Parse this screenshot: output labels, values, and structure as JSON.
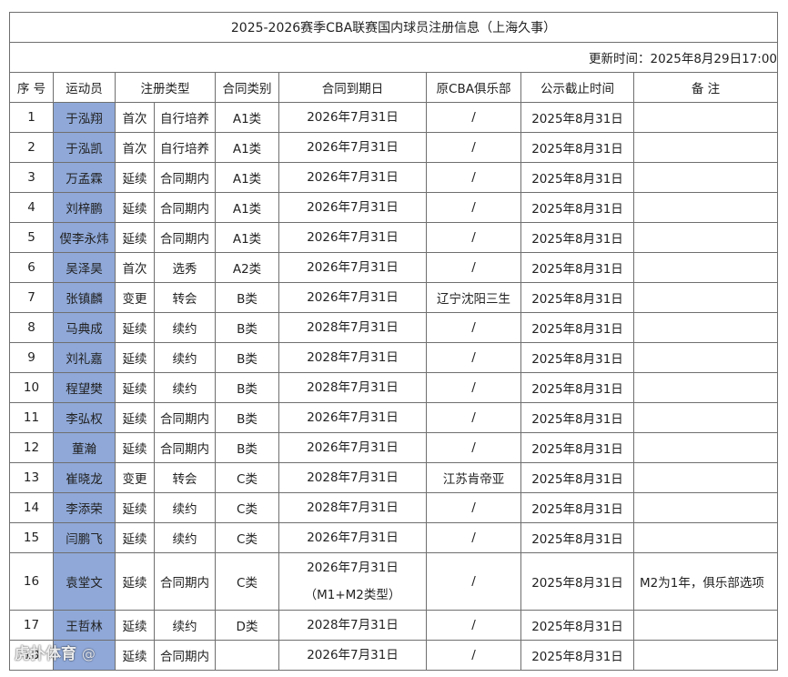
{
  "title": "2025-2026赛季CBA联赛国内球员注册信息（上海久事）",
  "update_time": "更新时间：2025年8月29日17:00",
  "headers": [
    "序 号",
    "运动员",
    "注册类型",
    "合同类别",
    "合同到期日",
    "原CBA俱乐部",
    "公示截止时间",
    "备 注"
  ],
  "rows": [
    {
      "no": "1",
      "athlete": "于泓翔",
      "reg_type": "首次",
      "reg_sub": "自行培养",
      "contract_class": "A1类",
      "expiry": "2026年7月31日",
      "expiry_note": "",
      "former_club": "/",
      "deadline": "2025年8月31日",
      "note": ""
    },
    {
      "no": "2",
      "athlete": "于泓凯",
      "reg_type": "首次",
      "reg_sub": "自行培养",
      "contract_class": "A1类",
      "expiry": "2026年7月31日",
      "expiry_note": "",
      "former_club": "/",
      "deadline": "2025年8月31日",
      "note": ""
    },
    {
      "no": "3",
      "athlete": "万孟霖",
      "reg_type": "延续",
      "reg_sub": "合同期内",
      "contract_class": "A1类",
      "expiry": "2026年7月31日",
      "expiry_note": "",
      "former_club": "/",
      "deadline": "2025年8月31日",
      "note": ""
    },
    {
      "no": "4",
      "athlete": "刘梓鹏",
      "reg_type": "延续",
      "reg_sub": "合同期内",
      "contract_class": "A1类",
      "expiry": "2026年7月31日",
      "expiry_note": "",
      "former_club": "/",
      "deadline": "2025年8月31日",
      "note": ""
    },
    {
      "no": "5",
      "athlete": "偰李永炜",
      "reg_type": "延续",
      "reg_sub": "合同期内",
      "contract_class": "A1类",
      "expiry": "2026年7月31日",
      "expiry_note": "",
      "former_club": "/",
      "deadline": "2025年8月31日",
      "note": ""
    },
    {
      "no": "6",
      "athlete": "吴泽昊",
      "reg_type": "首次",
      "reg_sub": "选秀",
      "contract_class": "A2类",
      "expiry": "2026年7月31日",
      "expiry_note": "",
      "former_club": "/",
      "deadline": "2025年8月31日",
      "note": ""
    },
    {
      "no": "7",
      "athlete": "张镇麟",
      "reg_type": "变更",
      "reg_sub": "转会",
      "contract_class": "B类",
      "expiry": "2026年7月31日",
      "expiry_note": "",
      "former_club": "辽宁沈阳三生",
      "deadline": "2025年8月31日",
      "note": ""
    },
    {
      "no": "8",
      "athlete": "马典成",
      "reg_type": "延续",
      "reg_sub": "续约",
      "contract_class": "B类",
      "expiry": "2028年7月31日",
      "expiry_note": "",
      "former_club": "/",
      "deadline": "2025年8月31日",
      "note": ""
    },
    {
      "no": "9",
      "athlete": "刘礼嘉",
      "reg_type": "延续",
      "reg_sub": "续约",
      "contract_class": "B类",
      "expiry": "2028年7月31日",
      "expiry_note": "",
      "former_club": "/",
      "deadline": "2025年8月31日",
      "note": ""
    },
    {
      "no": "10",
      "athlete": "程望樊",
      "reg_type": "延续",
      "reg_sub": "续约",
      "contract_class": "B类",
      "expiry": "2028年7月31日",
      "expiry_note": "",
      "former_club": "/",
      "deadline": "2025年8月31日",
      "note": ""
    },
    {
      "no": "11",
      "athlete": "李弘权",
      "reg_type": "延续",
      "reg_sub": "合同期内",
      "contract_class": "B类",
      "expiry": "2026年7月31日",
      "expiry_note": "",
      "former_club": "/",
      "deadline": "2025年8月31日",
      "note": ""
    },
    {
      "no": "12",
      "athlete": "董瀚",
      "reg_type": "延续",
      "reg_sub": "合同期内",
      "contract_class": "B类",
      "expiry": "2026年7月31日",
      "expiry_note": "",
      "former_club": "/",
      "deadline": "2025年8月31日",
      "note": ""
    },
    {
      "no": "13",
      "athlete": "崔晓龙",
      "reg_type": "变更",
      "reg_sub": "转会",
      "contract_class": "C类",
      "expiry": "2028年7月31日",
      "expiry_note": "",
      "former_club": "江苏肯帝亚",
      "deadline": "2025年8月31日",
      "note": ""
    },
    {
      "no": "14",
      "athlete": "李添荣",
      "reg_type": "延续",
      "reg_sub": "续约",
      "contract_class": "C类",
      "expiry": "2028年7月31日",
      "expiry_note": "",
      "former_club": "/",
      "deadline": "2025年8月31日",
      "note": ""
    },
    {
      "no": "15",
      "athlete": "闫鹏飞",
      "reg_type": "延续",
      "reg_sub": "续约",
      "contract_class": "C类",
      "expiry": "2026年7月31日",
      "expiry_note": "",
      "former_club": "/",
      "deadline": "2025年8月31日",
      "note": ""
    },
    {
      "no": "16",
      "athlete": "袁堂文",
      "reg_type": "延续",
      "reg_sub": "合同期内",
      "contract_class": "C类",
      "expiry": "2026年7月31日",
      "expiry_note": "（M1+M2类型）",
      "former_club": "/",
      "deadline": "2025年8月31日",
      "note": "M2为1年，俱乐部选项"
    },
    {
      "no": "17",
      "athlete": "王哲林",
      "reg_type": "延续",
      "reg_sub": "续约",
      "contract_class": "D类",
      "expiry": "2028年7月31日",
      "expiry_note": "",
      "former_club": "/",
      "deadline": "2025年8月31日",
      "note": ""
    },
    {
      "no": "18",
      "athlete": "",
      "reg_type": "延续",
      "reg_sub": "合同期内",
      "contract_class": "",
      "expiry": "2026年7月31日",
      "expiry_note": "",
      "former_club": "/",
      "deadline": "2025年8月31日",
      "note": ""
    }
  ],
  "watermark": {
    "brand": "虎扑体育",
    "handle": "@"
  },
  "colors": {
    "athlete_cell_bg": "#8fa8d8",
    "border": "#6f6f6f",
    "text": "#222222"
  }
}
